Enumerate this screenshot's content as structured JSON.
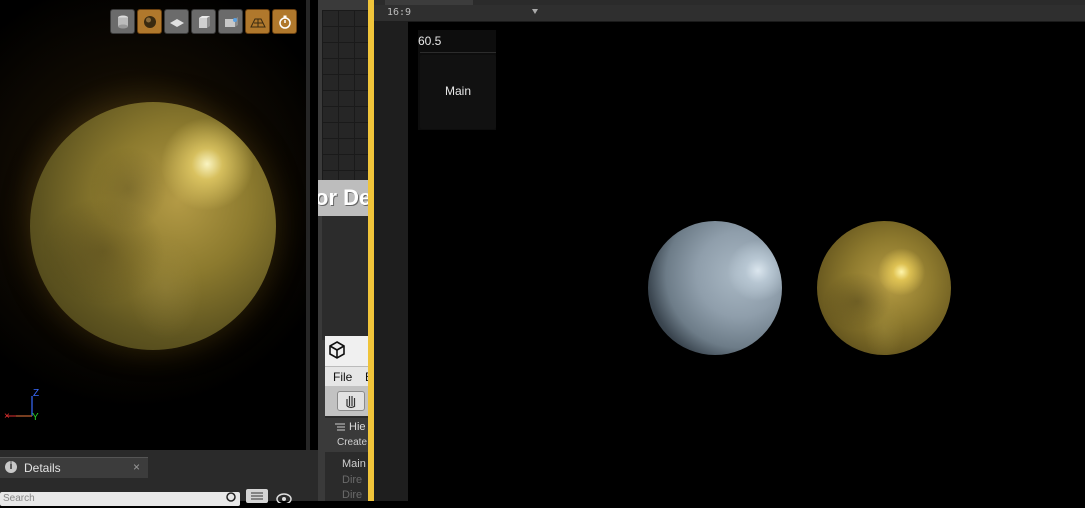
{
  "unreal": {
    "toolbar_icons": [
      "cylinder-icon",
      "sphere-icon",
      "plane-icon",
      "cube-icon",
      "custom-mesh-icon",
      "grid-icon",
      "realtime-icon"
    ],
    "axis": {
      "z_label": "Z",
      "y_label": "Y"
    },
    "details": {
      "tab_label": "Details",
      "close_label": "×",
      "search_placeholder": "Search"
    }
  },
  "background_editor": {
    "title_fragment": "or De",
    "unity_menu": [
      "File",
      "E"
    ],
    "hierarchy": {
      "header": "Hie",
      "create_label": "Create",
      "items": [
        "Main",
        "Dire",
        "Dire"
      ]
    }
  },
  "game_view": {
    "aspect": "16:9",
    "fps": "60.5",
    "main_button": "Main"
  },
  "colors": {
    "divider_accent": "#f0c43a",
    "active_toolbar_button": "#b0782c"
  }
}
